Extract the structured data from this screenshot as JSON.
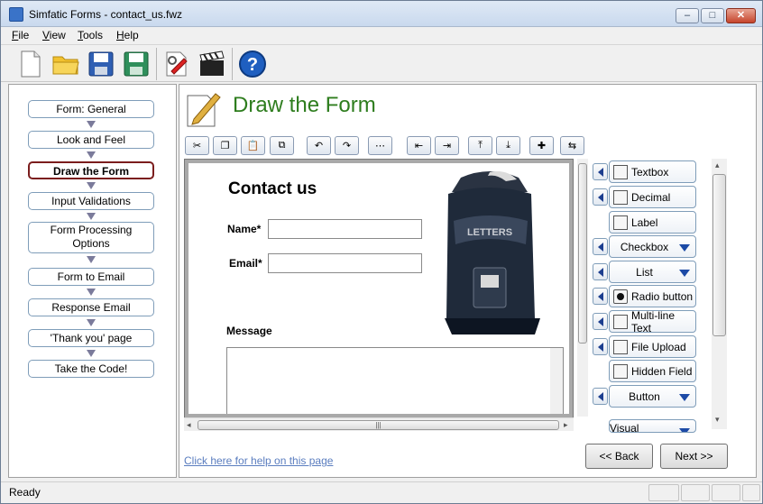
{
  "window": {
    "title": "Simfatic Forms - contact_us.fwz",
    "app_icon": "app-icon"
  },
  "menu": [
    {
      "label": "File",
      "accel": "F"
    },
    {
      "label": "View",
      "accel": "V"
    },
    {
      "label": "Tools",
      "accel": "T"
    },
    {
      "label": "Help",
      "accel": "H"
    }
  ],
  "toolbar": [
    "new-document-icon",
    "open-folder-icon",
    "save-icon",
    "save-as-icon",
    "form-settings-icon",
    "preview-clapper-icon",
    "help-icon"
  ],
  "steps": [
    {
      "label": "Form: General"
    },
    {
      "label": "Look and Feel"
    },
    {
      "label": "Draw the Form",
      "active": true
    },
    {
      "label": "Input Validations"
    },
    {
      "label": "Form Processing Options"
    },
    {
      "label": "Form to Email"
    },
    {
      "label": "Response Email"
    },
    {
      "label": "'Thank you' page"
    },
    {
      "label": "Take the Code!"
    }
  ],
  "page": {
    "title": "Draw the Form"
  },
  "form_toolbar": [
    "cut-icon",
    "copy-icon",
    "paste-icon",
    "duplicate-icon",
    "undo-icon",
    "redo-icon",
    "grid-icon",
    "align-left-icon",
    "align-right-icon",
    "align-top-icon",
    "align-bottom-icon",
    "center-icon",
    "tab-order-icon"
  ],
  "form": {
    "title": "Contact us",
    "name_label": "Name*",
    "email_label": "Email*",
    "message_label": "Message",
    "image_text": "LETTERS",
    "image_icon": "mailbox-image"
  },
  "palette": [
    {
      "label": "Textbox",
      "icon": "textbox-icon",
      "arrow": true,
      "dropdown": false
    },
    {
      "label": "Decimal",
      "icon": "decimal-icon",
      "arrow": true,
      "dropdown": false
    },
    {
      "label": "Label",
      "icon": "label-icon",
      "arrow": false,
      "dropdown": false
    },
    {
      "label": "Checkbox",
      "icon": "",
      "arrow": true,
      "dropdown": true
    },
    {
      "label": "List",
      "icon": "",
      "arrow": true,
      "dropdown": true
    },
    {
      "label": "Radio button",
      "icon": "radio-icon",
      "arrow": true,
      "dropdown": false
    },
    {
      "label": "Multi-line Text",
      "icon": "multiline-icon",
      "arrow": true,
      "dropdown": false
    },
    {
      "label": "File Upload",
      "icon": "file-upload-icon",
      "arrow": true,
      "dropdown": false
    },
    {
      "label": "Hidden Field",
      "icon": "hidden-field-icon",
      "arrow": false,
      "dropdown": false
    },
    {
      "label": "Button",
      "icon": "",
      "arrow": true,
      "dropdown": true
    },
    {
      "label": "Visual Element",
      "icon": "",
      "arrow": false,
      "dropdown": true
    }
  ],
  "help_link": "Click here for help on this page",
  "nav": {
    "back": "<< Back",
    "next": "Next >>"
  },
  "status": {
    "text": "Ready"
  },
  "colors": {
    "title_green": "#2e7d1e",
    "active_step_border": "#7b1d1d",
    "link": "#5a7dbf"
  }
}
